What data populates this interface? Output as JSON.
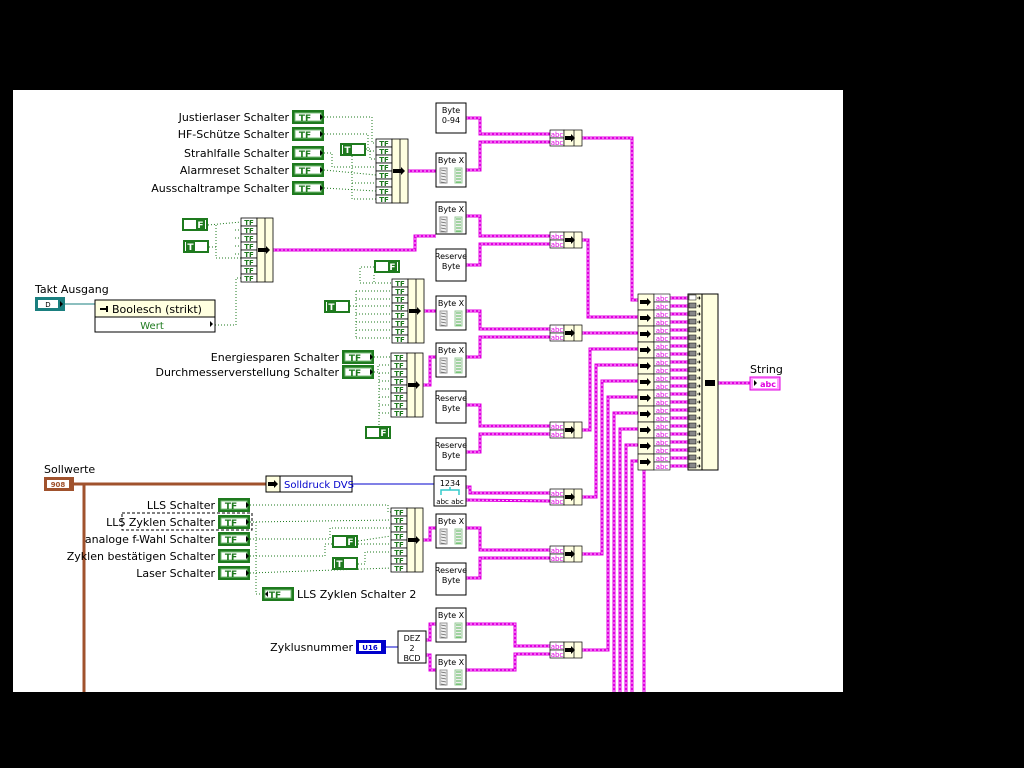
{
  "labels": {
    "justierlaser": "Justierlaser Schalter",
    "hf_schuetze": "HF-Schütze Schalter",
    "strahlfalle": "Strahlfalle Schalter",
    "alarmreset": "Alarmreset Schalter",
    "ausschaltrampe": "Ausschaltrampe Schalter",
    "takt_ausgang": "Takt Ausgang",
    "energiesparen": "Energiesparen Schalter",
    "durchmesser": "Durchmesserverstellung Schalter",
    "sollwerte": "Sollwerte",
    "lls": "LLS Schalter",
    "lls_zyklen": "LLS Zyklen Schalter",
    "analoge_f": "analoge f-Wahl Schalter",
    "zyklen_best": "Zyklen bestätigen Schalter",
    "laser": "Laser Schalter",
    "lls_zyklen_2": "LLS Zyklen Schalter 2",
    "zyklusnummer": "Zyklusnummer",
    "string": "String"
  },
  "property_node": {
    "class": "Boolesch (strikt)",
    "property": "Wert"
  },
  "unbundle": {
    "element": "Solldruck DVS"
  },
  "subvi": {
    "byte_0_94": [
      "Byte",
      "0-94"
    ],
    "byte_x": "Byte X",
    "reserve_byte": [
      "Reserve",
      "Byte"
    ],
    "dez_2_bcd": [
      "DEZ",
      "2",
      "BCD"
    ],
    "num_to_str": [
      "1234",
      "abc abc"
    ]
  },
  "terminals": {
    "bool": "TF",
    "true_const": "T",
    "false_const": "F",
    "string": "abc",
    "u16": "U16",
    "cluster": "908",
    "refnum": "D"
  },
  "colors": {
    "background": "#000000",
    "diagram": "#ffffff",
    "boolean": "#1e7a1e",
    "string": "#ff00ff",
    "cluster": "#a0522d",
    "integer": "#0000cc",
    "refnum": "#1a7f7f",
    "node_fill": "#ffffe0"
  }
}
